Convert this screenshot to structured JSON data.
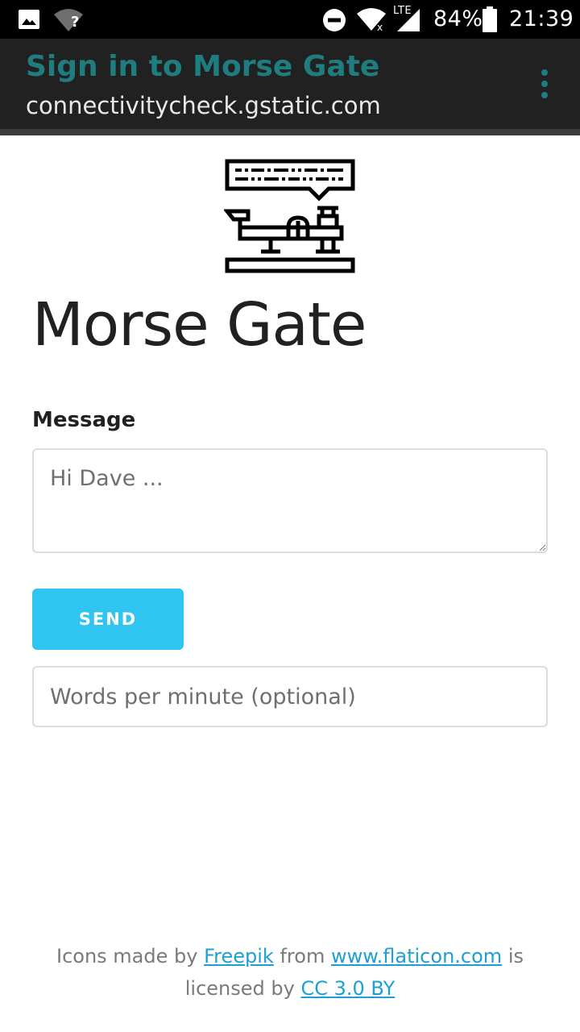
{
  "status_bar": {
    "battery_percent": "84%",
    "time": "21:39",
    "network_label": "LTE",
    "wifi_unknown_mark": "?",
    "icons": [
      "image-icon",
      "wifi-question-icon",
      "do-not-disturb-icon",
      "wifi-x-icon",
      "signal-icon",
      "battery-icon"
    ]
  },
  "header": {
    "title": "Sign in to Morse Gate",
    "subtitle": "connectivitycheck.gstatic.com",
    "menu_icon": "overflow-menu-icon"
  },
  "main": {
    "logo_icon": "morse-telegraph-icon",
    "title": "Morse Gate",
    "message_label": "Message",
    "message_placeholder": "Hi Dave ...",
    "send_label": "SEND",
    "wpm_placeholder": "Words per minute (optional)"
  },
  "footer": {
    "text_1": "Icons made by",
    "link_freepik": "Freepik",
    "text_2": "from",
    "link_flaticon": "www.flaticon.com",
    "text_3": "is licensed by",
    "link_license": "CC 3.0 BY"
  },
  "colors": {
    "accent": "#30c4f0",
    "header_title": "#1f7d7f",
    "link": "#1e9fd3"
  }
}
